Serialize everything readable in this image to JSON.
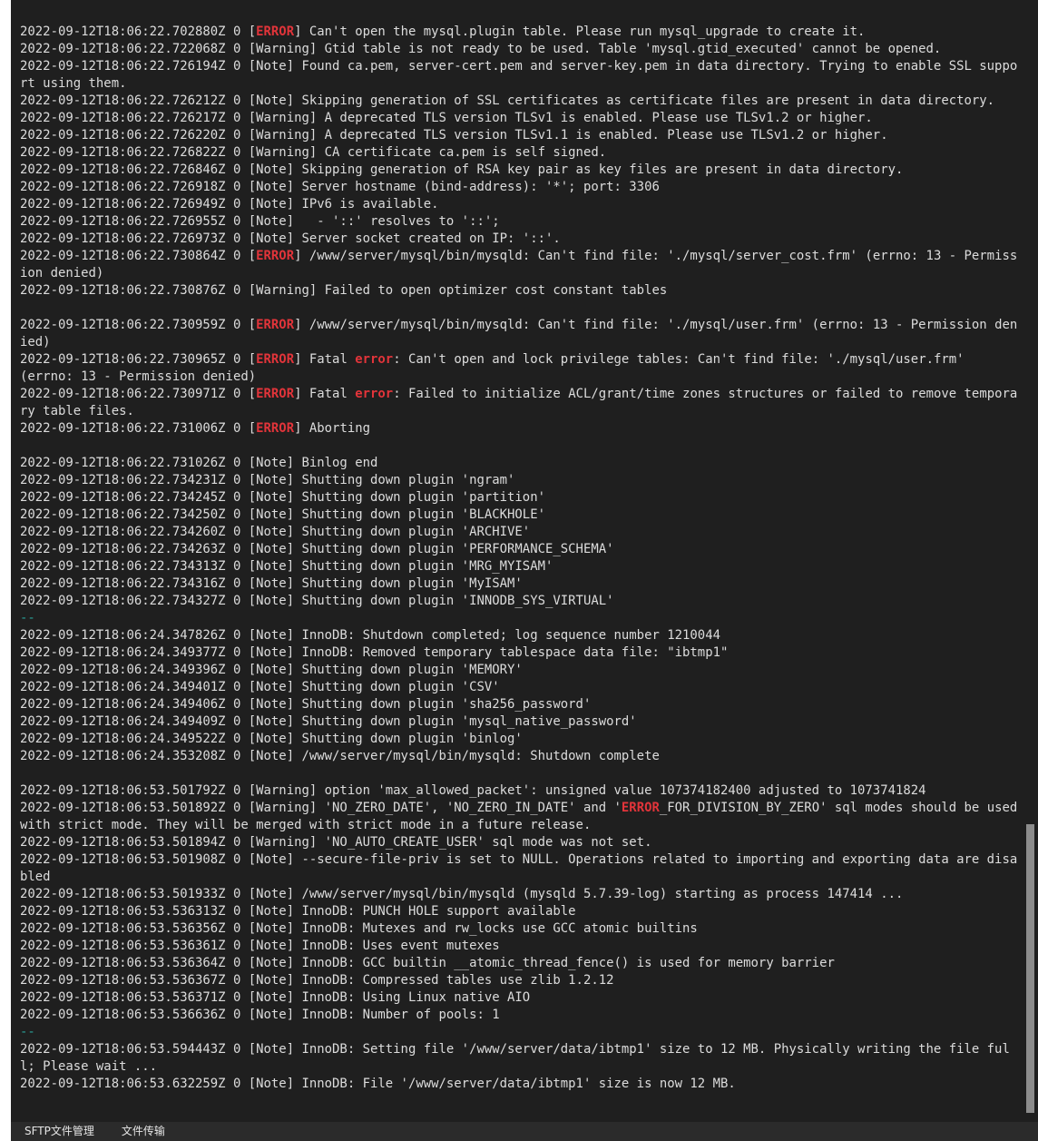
{
  "bottom_tabs": [
    "SFTP文件管理",
    "文件传输"
  ],
  "highlight_color": "#e2343a",
  "log_lines": [
    [
      {
        "t": "2022-09-12T18:06:22.702880Z 0 ["
      },
      {
        "t": "ERROR",
        "e": 1
      },
      {
        "t": "] Can't open the mysql.plugin table. Please run mysql_upgrade to create it."
      }
    ],
    [
      {
        "t": "2022-09-12T18:06:22.722068Z 0 [Warning] Gtid table is not ready to be used. Table 'mysql.gtid_executed' cannot be opened."
      }
    ],
    [
      {
        "t": "2022-09-12T18:06:22.726194Z 0 [Note] Found ca.pem, server-cert.pem and server-key.pem in data directory. Trying to enable SSL support using them."
      }
    ],
    [
      {
        "t": "2022-09-12T18:06:22.726212Z 0 [Note] Skipping generation of SSL certificates as certificate files are present in data directory."
      }
    ],
    [
      {
        "t": "2022-09-12T18:06:22.726217Z 0 [Warning] A deprecated TLS version TLSv1 is enabled. Please use TLSv1.2 or higher."
      }
    ],
    [
      {
        "t": "2022-09-12T18:06:22.726220Z 0 [Warning] A deprecated TLS version TLSv1.1 is enabled. Please use TLSv1.2 or higher."
      }
    ],
    [
      {
        "t": "2022-09-12T18:06:22.726822Z 0 [Warning] CA certificate ca.pem is self signed."
      }
    ],
    [
      {
        "t": "2022-09-12T18:06:22.726846Z 0 [Note] Skipping generation of RSA key pair as key files are present in data directory."
      }
    ],
    [
      {
        "t": "2022-09-12T18:06:22.726918Z 0 [Note] Server hostname (bind-address): '*'; port: 3306"
      }
    ],
    [
      {
        "t": "2022-09-12T18:06:22.726949Z 0 [Note] IPv6 is available."
      }
    ],
    [
      {
        "t": "2022-09-12T18:06:22.726955Z 0 [Note]   - '::' resolves to '::';"
      }
    ],
    [
      {
        "t": "2022-09-12T18:06:22.726973Z 0 [Note] Server socket created on IP: '::'."
      }
    ],
    [
      {
        "t": "2022-09-12T18:06:22.730864Z 0 ["
      },
      {
        "t": "ERROR",
        "e": 1
      },
      {
        "t": "] /www/server/mysql/bin/mysqld: Can't find file: './mysql/server_cost.frm' (errno: 13 - Permission denied)"
      }
    ],
    [
      {
        "t": "2022-09-12T18:06:22.730876Z 0 [Warning] Failed to open optimizer cost constant tables"
      }
    ],
    [],
    [
      {
        "t": "2022-09-12T18:06:22.730959Z 0 ["
      },
      {
        "t": "ERROR",
        "e": 1
      },
      {
        "t": "] /www/server/mysql/bin/mysqld: Can't find file: './mysql/user.frm' (errno: 13 - Permission denied)"
      }
    ],
    [
      {
        "t": "2022-09-12T18:06:22.730965Z 0 ["
      },
      {
        "t": "ERROR",
        "e": 1
      },
      {
        "t": "] Fatal "
      },
      {
        "t": "error",
        "e": 1
      },
      {
        "t": ": Can't open and lock privilege tables: Can't find file: './mysql/user.frm'"
      },
      {
        "t": "(errno: 13 - Permission denied)",
        "nl": 1
      }
    ],
    [
      {
        "t": "2022-09-12T18:06:22.730971Z 0 ["
      },
      {
        "t": "ERROR",
        "e": 1
      },
      {
        "t": "] Fatal "
      },
      {
        "t": "error",
        "e": 1
      },
      {
        "t": ": Failed to initialize ACL/grant/time zones structures or failed to remove temporary table files."
      }
    ],
    [
      {
        "t": "2022-09-12T18:06:22.731006Z 0 ["
      },
      {
        "t": "ERROR",
        "e": 1
      },
      {
        "t": "] Aborting"
      }
    ],
    [],
    [
      {
        "t": "2022-09-12T18:06:22.731026Z 0 [Note] Binlog end"
      }
    ],
    [
      {
        "t": "2022-09-12T18:06:22.734231Z 0 [Note] Shutting down plugin 'ngram'"
      }
    ],
    [
      {
        "t": "2022-09-12T18:06:22.734245Z 0 [Note] Shutting down plugin 'partition'"
      }
    ],
    [
      {
        "t": "2022-09-12T18:06:22.734250Z 0 [Note] Shutting down plugin 'BLACKHOLE'"
      }
    ],
    [
      {
        "t": "2022-09-12T18:06:22.734260Z 0 [Note] Shutting down plugin 'ARCHIVE'"
      }
    ],
    [
      {
        "t": "2022-09-12T18:06:22.734263Z 0 [Note] Shutting down plugin 'PERFORMANCE_SCHEMA'"
      }
    ],
    [
      {
        "t": "2022-09-12T18:06:22.734313Z 0 [Note] Shutting down plugin 'MRG_MYISAM'"
      }
    ],
    [
      {
        "t": "2022-09-12T18:06:22.734316Z 0 [Note] Shutting down plugin 'MyISAM'"
      }
    ],
    [
      {
        "t": "2022-09-12T18:06:22.734327Z 0 [Note] Shutting down plugin 'INNODB_SYS_VIRTUAL'"
      }
    ],
    [
      {
        "t": "--",
        "s": 1
      }
    ],
    [
      {
        "t": "2022-09-12T18:06:24.347826Z 0 [Note] InnoDB: Shutdown completed; log sequence number 1210044"
      }
    ],
    [
      {
        "t": "2022-09-12T18:06:24.349377Z 0 [Note] InnoDB: Removed temporary tablespace data file: \"ibtmp1\""
      }
    ],
    [
      {
        "t": "2022-09-12T18:06:24.349396Z 0 [Note] Shutting down plugin 'MEMORY'"
      }
    ],
    [
      {
        "t": "2022-09-12T18:06:24.349401Z 0 [Note] Shutting down plugin 'CSV'"
      }
    ],
    [
      {
        "t": "2022-09-12T18:06:24.349406Z 0 [Note] Shutting down plugin 'sha256_password'"
      }
    ],
    [
      {
        "t": "2022-09-12T18:06:24.349409Z 0 [Note] Shutting down plugin 'mysql_native_password'"
      }
    ],
    [
      {
        "t": "2022-09-12T18:06:24.349522Z 0 [Note] Shutting down plugin 'binlog'"
      }
    ],
    [
      {
        "t": "2022-09-12T18:06:24.353208Z 0 [Note] /www/server/mysql/bin/mysqld: Shutdown complete"
      }
    ],
    [],
    [
      {
        "t": "2022-09-12T18:06:53.501792Z 0 [Warning] option 'max_allowed_packet': unsigned value 107374182400 adjusted to 1073741824"
      }
    ],
    [
      {
        "t": "2022-09-12T18:06:53.501892Z 0 [Warning] 'NO_ZERO_DATE', 'NO_ZERO_IN_DATE' and '"
      },
      {
        "t": "ERROR",
        "e": 1
      },
      {
        "t": "_FOR_DIVISION_BY_ZERO' sql modes should be used with strict mode. They will be merged with strict mode in a future release."
      }
    ],
    [
      {
        "t": "2022-09-12T18:06:53.501894Z 0 [Warning] 'NO_AUTO_CREATE_USER' sql mode was not set."
      }
    ],
    [
      {
        "t": "2022-09-12T18:06:53.501908Z 0 [Note] --secure-file-priv is set to NULL. Operations related to importing and exporting data are disabled"
      }
    ],
    [
      {
        "t": "2022-09-12T18:06:53.501933Z 0 [Note] /www/server/mysql/bin/mysqld (mysqld 5.7.39-log) starting as process 147414 ..."
      }
    ],
    [
      {
        "t": "2022-09-12T18:06:53.536313Z 0 [Note] InnoDB: PUNCH HOLE support available"
      }
    ],
    [
      {
        "t": "2022-09-12T18:06:53.536356Z 0 [Note] InnoDB: Mutexes and rw_locks use GCC atomic builtins"
      }
    ],
    [
      {
        "t": "2022-09-12T18:06:53.536361Z 0 [Note] InnoDB: Uses event mutexes"
      }
    ],
    [
      {
        "t": "2022-09-12T18:06:53.536364Z 0 [Note] InnoDB: GCC builtin __atomic_thread_fence() is used for memory barrier"
      }
    ],
    [
      {
        "t": "2022-09-12T18:06:53.536367Z 0 [Note] InnoDB: Compressed tables use zlib 1.2.12"
      }
    ],
    [
      {
        "t": "2022-09-12T18:06:53.536371Z 0 [Note] InnoDB: Using Linux native AIO"
      }
    ],
    [
      {
        "t": "2022-09-12T18:06:53.536636Z 0 [Note] InnoDB: Number of pools: 1"
      }
    ],
    [
      {
        "t": "--",
        "s": 1
      }
    ],
    [
      {
        "t": "2022-09-12T18:06:53.594443Z 0 [Note] InnoDB: Setting file '/www/server/data/ibtmp1' size to 12 MB. Physically writing the file full; Please wait ..."
      }
    ],
    [
      {
        "t": "2022-09-12T18:06:53.632259Z 0 [Note] InnoDB: File '/www/server/data/ibtmp1' size is now 12 MB."
      }
    ]
  ]
}
